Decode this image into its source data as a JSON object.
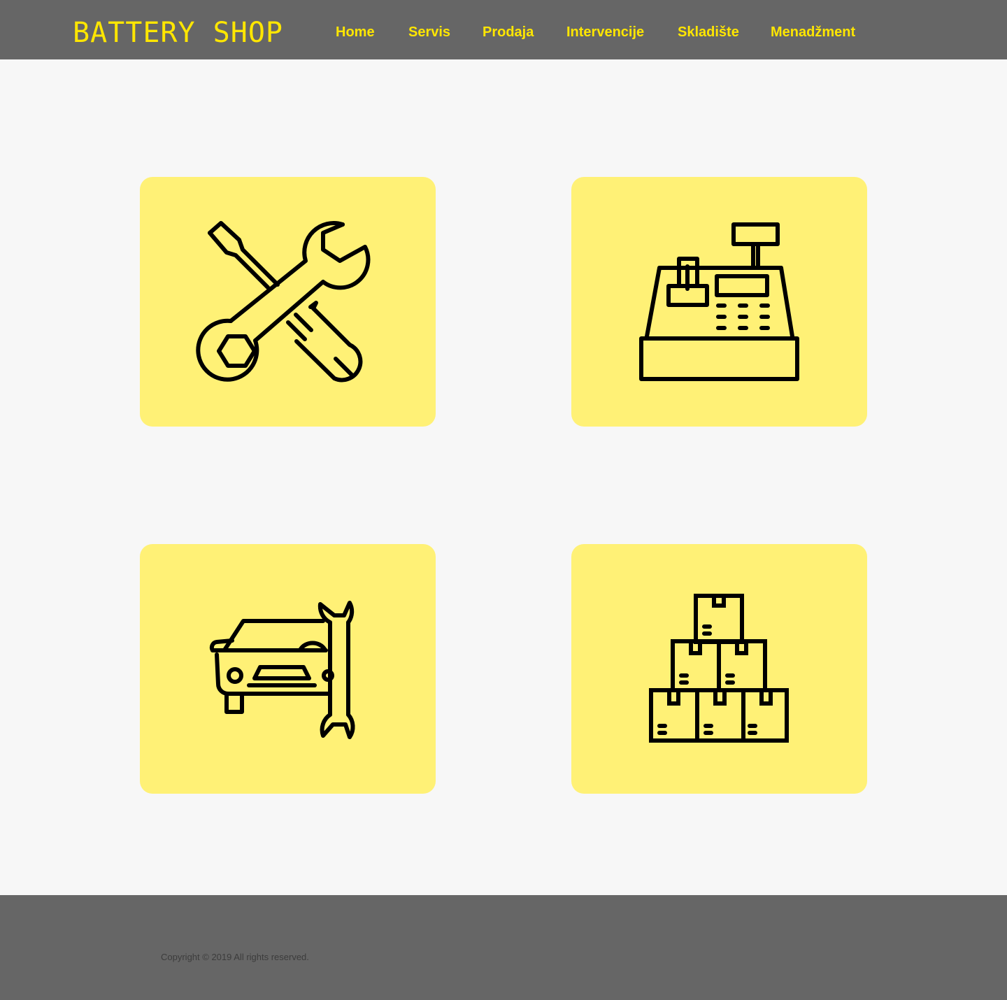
{
  "header": {
    "logo_text": "BATTERY SHOP",
    "nav": [
      {
        "label": "Home"
      },
      {
        "label": "Servis"
      },
      {
        "label": "Prodaja"
      },
      {
        "label": "Intervencije"
      },
      {
        "label": "Skladište"
      },
      {
        "label": "Menadžment"
      }
    ]
  },
  "cards": [
    {
      "icon": "tools-icon"
    },
    {
      "icon": "cash-register-icon"
    },
    {
      "icon": "car-repair-icon"
    },
    {
      "icon": "boxes-icon"
    }
  ],
  "footer": {
    "copyright": "Copyright © 2019 All rights reserved."
  },
  "colors": {
    "header_bg": "#666666",
    "accent_yellow": "#ffe600",
    "card_bg": "#fff176",
    "page_bg": "#f7f7f7",
    "icon_stroke": "#000000"
  }
}
